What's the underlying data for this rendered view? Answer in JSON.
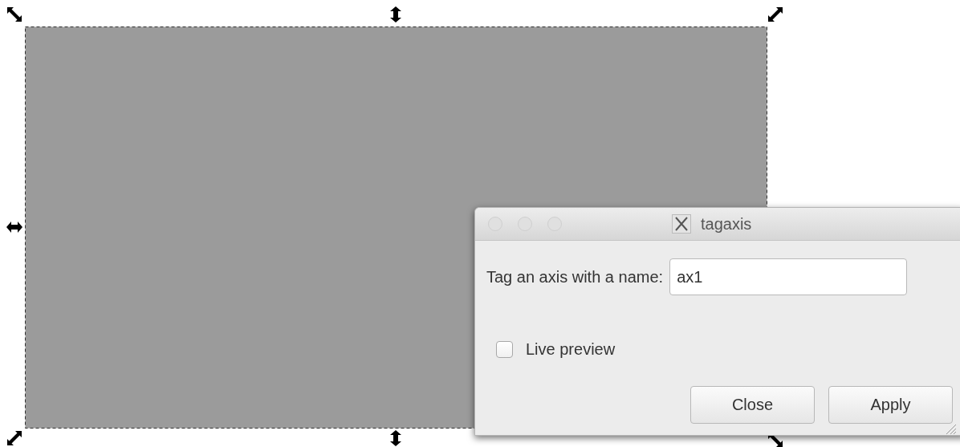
{
  "dialog": {
    "title": "tagaxis",
    "field_label": "Tag an axis with a name:",
    "field_value": "ax1",
    "checkbox": {
      "label": "Live preview",
      "checked": false
    },
    "buttons": [
      "Close",
      "Apply"
    ]
  }
}
